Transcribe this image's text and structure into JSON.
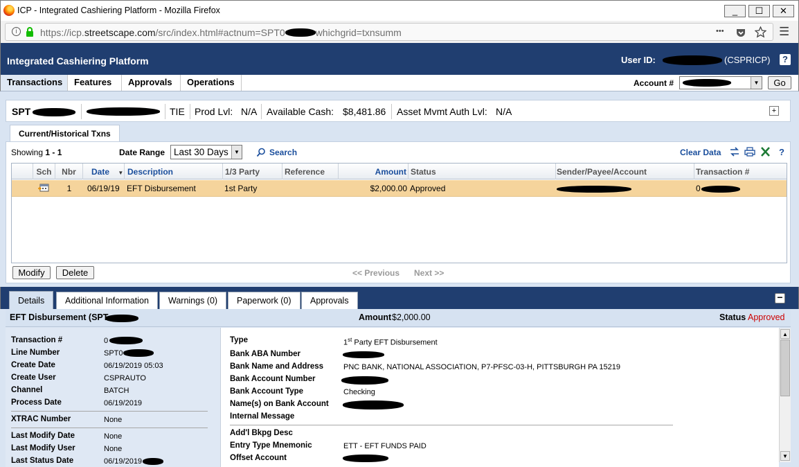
{
  "window": {
    "title": "ICP - Integrated Cashiering Platform - Mozilla Firefox",
    "min_glyph": "_",
    "max_glyph": "☐",
    "close_glyph": "✕"
  },
  "browser": {
    "url_prefix": "https://icp.",
    "url_domain": "streetscape.com",
    "url_path_a": "/src/index.html#actnum=SPT0",
    "url_path_b": "whichgrid=txnsumm",
    "more_glyph": "•••",
    "menu_glyph": "☰"
  },
  "app": {
    "title": "Integrated Cashiering Platform",
    "user_label": "User ID:",
    "user_code": "(CSPRICP)",
    "help": "?"
  },
  "nav": {
    "tabs": [
      "Transactions",
      "Features",
      "Approvals",
      "Operations"
    ],
    "account_label": "Account #",
    "go": "Go"
  },
  "infobar": {
    "account_prefix": "SPT",
    "tie": "TIE",
    "prod_lvl_label": "Prod Lvl:",
    "prod_lvl_value": "N/A",
    "avail_cash_label": "Available Cash:",
    "avail_cash_value": "$8,481.86",
    "asset_label": "Asset Mvmt Auth Lvl:",
    "asset_value": "N/A",
    "expand": "+"
  },
  "txn": {
    "subtab": "Current/Historical Txns",
    "showing_label": "Showing",
    "showing_range": "1 - 1",
    "date_range_label": "Date Range",
    "date_range_value": "Last 30 Days",
    "search": "Search",
    "clear": "Clear Data",
    "headers": {
      "sch": "Sch",
      "nbr": "Nbr",
      "date": "Date",
      "desc": "Description",
      "party": "1/3 Party",
      "ref": "Reference",
      "amount": "Amount",
      "status": "Status",
      "sender": "Sender/Payee/Account",
      "txnno": "Transaction #"
    },
    "rows": [
      {
        "nbr": "1",
        "date": "06/19/19",
        "desc": "EFT Disbursement",
        "party": "1st Party",
        "ref": "",
        "amount": "$2,000.00",
        "status": "Approved",
        "txn_prefix": "0"
      }
    ],
    "modify": "Modify",
    "delete": "Delete",
    "previous": "<< Previous",
    "next": "Next >>"
  },
  "detail": {
    "tabs": [
      "Details",
      "Additional Information",
      "Warnings (0)",
      "Paperwork (0)",
      "Approvals"
    ],
    "collapse": "−",
    "heading": "EFT Disbursement (SPT-",
    "amount_label": "Amount",
    "amount_value": "$2,000.00",
    "status_label": "Status",
    "status_value": "Approved",
    "status_color": "#cc0000",
    "left": {
      "txn_label": "Transaction #",
      "txn_value": "0",
      "line_label": "Line Number",
      "line_value": "SPT0",
      "create_date_label": "Create Date",
      "create_date_value": "06/19/2019 05:03",
      "create_user_label": "Create User",
      "create_user_value": "CSPRAUTO",
      "channel_label": "Channel",
      "channel_value": "BATCH",
      "process_date_label": "Process Date",
      "process_date_value": "06/19/2019",
      "xtrac_label": "XTRAC Number",
      "xtrac_value": "None",
      "lm_date_label": "Last Modify Date",
      "lm_date_value": "None",
      "lm_user_label": "Last Modify User",
      "lm_user_value": "None",
      "ls_date_label": "Last Status Date",
      "ls_date_value": "06/19/2019"
    },
    "right": {
      "type_label": "Type",
      "type_sup_pre": "1",
      "type_sup": "st",
      "type_rest": " Party EFT Disbursement",
      "aba_label": "Bank ABA Number",
      "bank_name_label": "Bank Name and Address",
      "bank_name_value": "PNC BANK, NATIONAL ASSOCIATION, P7-PFSC-03-H, PITTSBURGH PA 15219",
      "acct_num_label": "Bank Account Number",
      "acct_type_label": "Bank Account Type",
      "acct_type_value": "Checking",
      "names_label": "Name(s) on Bank Account",
      "internal_label": "Internal Message",
      "bkpg_label": "Add'l Bkpg Desc",
      "mnemonic_label": "Entry Type Mnemonic",
      "mnemonic_value": "ETT - EFT FUNDS PAID",
      "offset_label": "Offset Account"
    }
  }
}
